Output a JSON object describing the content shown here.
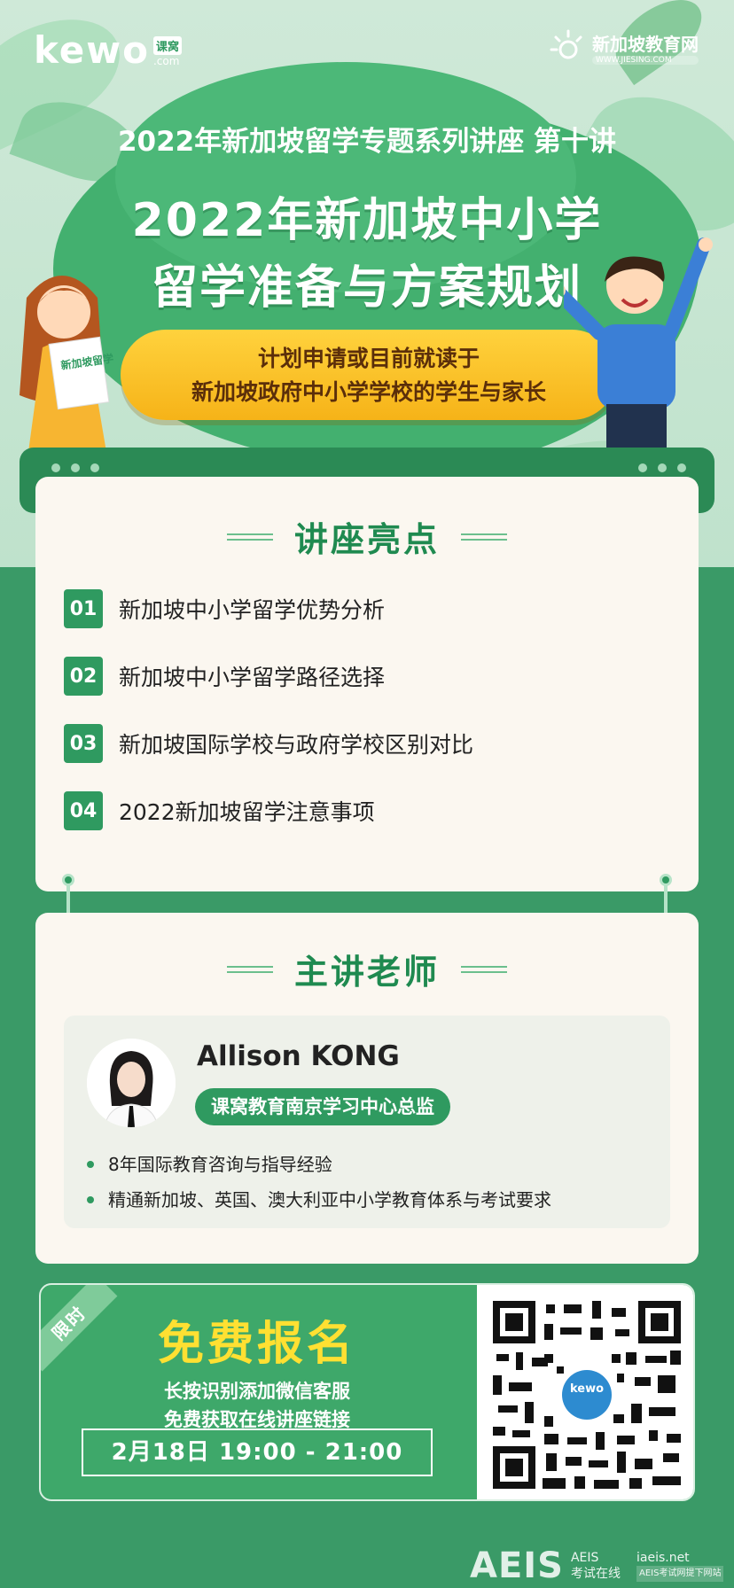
{
  "header": {
    "kewo_logo": "kewo",
    "kewo_tag": "课窝",
    "kewo_domain": ".com",
    "partner_name": "新加坡教育网",
    "partner_url": "WWW.JIESING.COM"
  },
  "hero": {
    "series": "2022年新加坡留学专题系列讲座 第十讲",
    "title_line1": "2022年新加坡中小学",
    "title_line2": "留学准备与方案规划",
    "audience_line1": "计划申请或目前就读于",
    "audience_line2": "新加坡政府中小学学校的学生与家长",
    "girl_board_text": "新加坡留学"
  },
  "highlights": {
    "title": "讲座亮点",
    "items": [
      {
        "num": "01",
        "text": "新加坡中小学留学优势分析"
      },
      {
        "num": "02",
        "text": "新加坡中小学留学路径选择"
      },
      {
        "num": "03",
        "text": "新加坡国际学校与政府学校区别对比"
      },
      {
        "num": "04",
        "text": "2022新加坡留学注意事项"
      }
    ]
  },
  "teacher": {
    "title": "主讲老师",
    "name": "Allison KONG",
    "role": "课窝教育南京学习中心总监",
    "bullets": [
      "8年国际教育咨询与指导经验",
      "精通新加坡、英国、澳大利亚中小学教育体系与考试要求"
    ]
  },
  "registration": {
    "ribbon": "限时",
    "title": "免费报名",
    "sub1": "长按识别添加微信客服",
    "sub2": "免费获取在线讲座链接",
    "time": "2月18日 19:00 - 21:00",
    "qr_center": "kewo"
  },
  "footer": {
    "logo": "AEIS",
    "col1": "AEIS",
    "col2": "考试在线",
    "site": "iaeis.net",
    "site_small": "AEIS考试网提下网站"
  },
  "colors": {
    "brand_green": "#2f9a60",
    "accent_yellow": "#ffe032",
    "pill_yellow": "#f6b318"
  }
}
